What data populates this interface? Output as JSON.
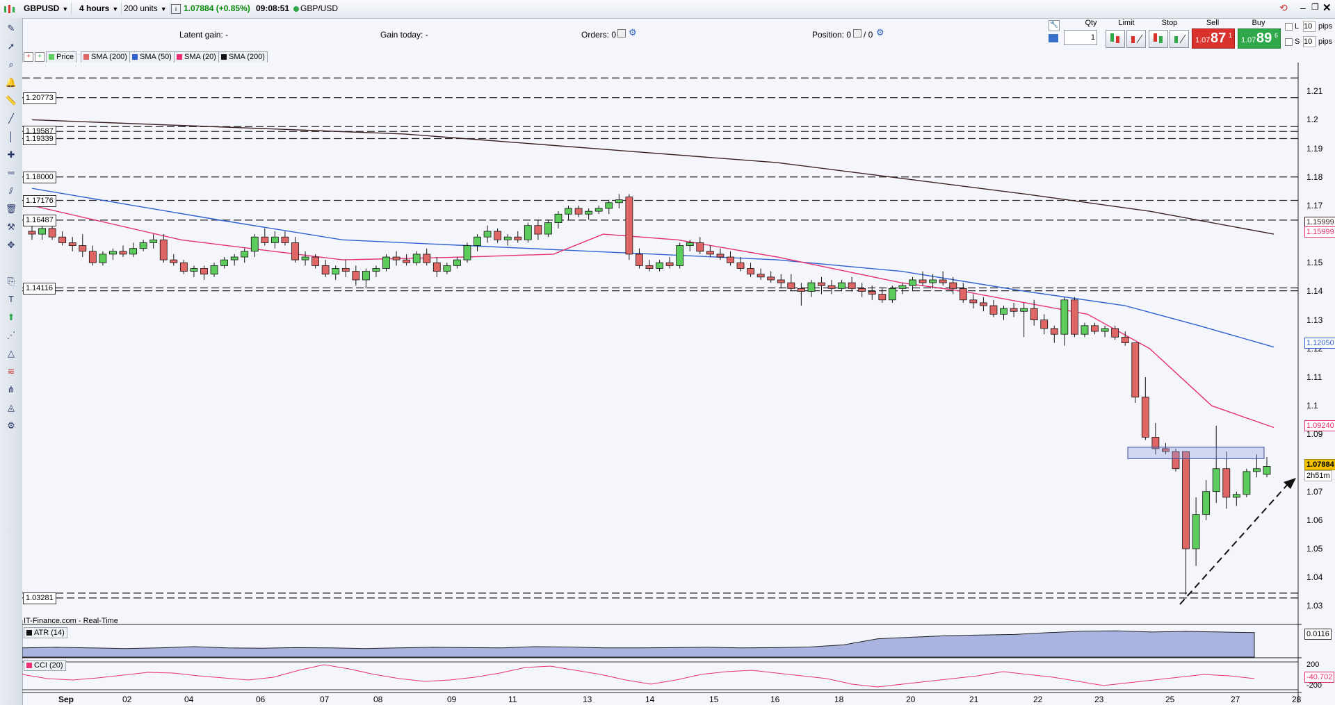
{
  "topbar": {
    "symbol": "GBPUSD",
    "timeframe": "4 hours",
    "units": "200 units",
    "price_change": "1.07884 (+0.85%)",
    "time": "09:08:51",
    "pair": "GBP/USD"
  },
  "infobar": {
    "latent_gain_label": "Latent gain:",
    "latent_gain_value": "-",
    "gain_today_label": "Gain today:",
    "gain_today_value": "-",
    "orders_label": "Orders:",
    "orders_value": "0",
    "position_label": "Position:",
    "position_value": "0",
    "position_sep": "/ 0"
  },
  "trade": {
    "qty_label": "Qty",
    "qty_value": "1",
    "limit_label": "Limit",
    "stop_label": "Stop",
    "sell_label": "Sell",
    "buy_label": "Buy",
    "sell_small": "1.07",
    "sell_big": "87",
    "sell_sup": "1",
    "buy_small": "1.07",
    "buy_big": "89",
    "buy_sup": "6",
    "l_label": "L",
    "s_label": "S",
    "l_pips": "10",
    "s_pips": "10",
    "pips_label": "pips"
  },
  "legend": {
    "price": "Price",
    "sma200a": "SMA (200)",
    "sma50": "SMA (50)",
    "sma20": "SMA (20)",
    "sma200b": "SMA (200)"
  },
  "colors": {
    "up": "#5ccc5c",
    "down": "#e06666",
    "sma200": "#3a2020",
    "sma50": "#3060d0",
    "sma20": "#e83070",
    "atr_fill": "#aab4e0",
    "zone": "#8f9de0"
  },
  "levels": [
    "1.20773",
    "1.19587",
    "1.19339",
    "1.18000",
    "1.17176",
    "1.16487",
    "1.14116",
    "1.03281"
  ],
  "right_badges": {
    "sma200": "1.15999",
    "sma20_top": "1.15999",
    "sma50": "1.12050",
    "sma20": "1.09240",
    "price": "1.07884",
    "countdown": "2h51m"
  },
  "source_label": "IT-Finance.com - Real-Time",
  "atr": {
    "label": "ATR (14)",
    "value": "0.0116"
  },
  "cci": {
    "label": "CCI (20)",
    "value": "-40.702",
    "upper": "200",
    "lower": "-200"
  },
  "chart_data": {
    "type": "candlestick",
    "ylim": [
      1.025,
      1.22
    ],
    "yticks": [
      "1.21",
      "1.2",
      "1.19",
      "1.18",
      "1.17",
      "1.16",
      "1.15",
      "1.14",
      "1.13",
      "1.12",
      "1.11",
      "1.1",
      "1.09",
      "1.08",
      "1.07",
      "1.06",
      "1.05",
      "1.04",
      "1.03"
    ],
    "xticks": [
      "Sep",
      "02",
      "04",
      "06",
      "07",
      "08",
      "09",
      "11",
      "13",
      "14",
      "15",
      "16",
      "18",
      "20",
      "21",
      "22",
      "23",
      "25",
      "27",
      "28"
    ],
    "dashed_levels": [
      1.2146,
      1.2077,
      1.1976,
      1.1959,
      1.1934,
      1.18,
      1.1718,
      1.1649,
      1.1412,
      1.1402,
      1.0345,
      1.0328
    ],
    "candles": [
      [
        1.161,
        1.164,
        1.158,
        1.16
      ],
      [
        1.16,
        1.163,
        1.158,
        1.162
      ],
      [
        1.162,
        1.164,
        1.158,
        1.159
      ],
      [
        1.159,
        1.161,
        1.156,
        1.157
      ],
      [
        1.157,
        1.159,
        1.154,
        1.156
      ],
      [
        1.156,
        1.16,
        1.152,
        1.154
      ],
      [
        1.154,
        1.156,
        1.149,
        1.15
      ],
      [
        1.15,
        1.154,
        1.149,
        1.153
      ],
      [
        1.153,
        1.155,
        1.151,
        1.154
      ],
      [
        1.154,
        1.156,
        1.152,
        1.153
      ],
      [
        1.153,
        1.157,
        1.152,
        1.155
      ],
      [
        1.155,
        1.158,
        1.154,
        1.157
      ],
      [
        1.157,
        1.16,
        1.155,
        1.158
      ],
      [
        1.158,
        1.16,
        1.15,
        1.151
      ],
      [
        1.151,
        1.153,
        1.149,
        1.15
      ],
      [
        1.15,
        1.151,
        1.146,
        1.147
      ],
      [
        1.147,
        1.149,
        1.145,
        1.148
      ],
      [
        1.148,
        1.149,
        1.144,
        1.146
      ],
      [
        1.146,
        1.15,
        1.145,
        1.149
      ],
      [
        1.149,
        1.152,
        1.148,
        1.151
      ],
      [
        1.151,
        1.153,
        1.149,
        1.152
      ],
      [
        1.152,
        1.155,
        1.15,
        1.154
      ],
      [
        1.154,
        1.16,
        1.152,
        1.159
      ],
      [
        1.159,
        1.162,
        1.156,
        1.157
      ],
      [
        1.157,
        1.161,
        1.155,
        1.159
      ],
      [
        1.159,
        1.161,
        1.156,
        1.157
      ],
      [
        1.157,
        1.159,
        1.15,
        1.151
      ],
      [
        1.151,
        1.154,
        1.149,
        1.152
      ],
      [
        1.152,
        1.153,
        1.148,
        1.149
      ],
      [
        1.149,
        1.151,
        1.145,
        1.146
      ],
      [
        1.146,
        1.149,
        1.144,
        1.148
      ],
      [
        1.148,
        1.151,
        1.145,
        1.147
      ],
      [
        1.147,
        1.149,
        1.142,
        1.144
      ],
      [
        1.144,
        1.148,
        1.141,
        1.147
      ],
      [
        1.147,
        1.149,
        1.145,
        1.148
      ],
      [
        1.148,
        1.153,
        1.147,
        1.152
      ],
      [
        1.152,
        1.154,
        1.149,
        1.151
      ],
      [
        1.151,
        1.153,
        1.149,
        1.15
      ],
      [
        1.15,
        1.154,
        1.149,
        1.153
      ],
      [
        1.153,
        1.155,
        1.149,
        1.15
      ],
      [
        1.15,
        1.152,
        1.145,
        1.147
      ],
      [
        1.147,
        1.15,
        1.146,
        1.149
      ],
      [
        1.149,
        1.152,
        1.148,
        1.151
      ],
      [
        1.151,
        1.157,
        1.15,
        1.156
      ],
      [
        1.156,
        1.16,
        1.154,
        1.159
      ],
      [
        1.159,
        1.163,
        1.157,
        1.161
      ],
      [
        1.161,
        1.162,
        1.157,
        1.158
      ],
      [
        1.158,
        1.16,
        1.156,
        1.159
      ],
      [
        1.159,
        1.161,
        1.157,
        1.158
      ],
      [
        1.158,
        1.164,
        1.157,
        1.163
      ],
      [
        1.163,
        1.165,
        1.158,
        1.16
      ],
      [
        1.16,
        1.165,
        1.159,
        1.164
      ],
      [
        1.164,
        1.168,
        1.162,
        1.167
      ],
      [
        1.167,
        1.17,
        1.165,
        1.169
      ],
      [
        1.169,
        1.17,
        1.166,
        1.167
      ],
      [
        1.167,
        1.169,
        1.165,
        1.168
      ],
      [
        1.168,
        1.17,
        1.167,
        1.169
      ],
      [
        1.169,
        1.172,
        1.167,
        1.171
      ],
      [
        1.171,
        1.174,
        1.169,
        1.172
      ],
      [
        1.173,
        1.174,
        1.151,
        1.153
      ],
      [
        1.153,
        1.155,
        1.148,
        1.149
      ],
      [
        1.149,
        1.151,
        1.147,
        1.148
      ],
      [
        1.148,
        1.151,
        1.147,
        1.15
      ],
      [
        1.15,
        1.152,
        1.148,
        1.149
      ],
      [
        1.149,
        1.157,
        1.148,
        1.156
      ],
      [
        1.156,
        1.158,
        1.154,
        1.157
      ],
      [
        1.157,
        1.159,
        1.153,
        1.154
      ],
      [
        1.154,
        1.156,
        1.152,
        1.153
      ],
      [
        1.153,
        1.155,
        1.151,
        1.152
      ],
      [
        1.152,
        1.154,
        1.149,
        1.15
      ],
      [
        1.15,
        1.152,
        1.147,
        1.148
      ],
      [
        1.148,
        1.15,
        1.145,
        1.146
      ],
      [
        1.146,
        1.148,
        1.144,
        1.145
      ],
      [
        1.145,
        1.147,
        1.143,
        1.144
      ],
      [
        1.144,
        1.146,
        1.141,
        1.143
      ],
      [
        1.143,
        1.146,
        1.14,
        1.141
      ],
      [
        1.141,
        1.143,
        1.135,
        1.14
      ],
      [
        1.14,
        1.144,
        1.138,
        1.143
      ],
      [
        1.143,
        1.145,
        1.139,
        1.142
      ],
      [
        1.142,
        1.144,
        1.139,
        1.141
      ],
      [
        1.141,
        1.144,
        1.14,
        1.143
      ],
      [
        1.143,
        1.145,
        1.14,
        1.141
      ],
      [
        1.141,
        1.143,
        1.138,
        1.14
      ],
      [
        1.14,
        1.142,
        1.137,
        1.139
      ],
      [
        1.139,
        1.141,
        1.136,
        1.137
      ],
      [
        1.137,
        1.142,
        1.136,
        1.141
      ],
      [
        1.141,
        1.143,
        1.139,
        1.142
      ],
      [
        1.142,
        1.145,
        1.14,
        1.144
      ],
      [
        1.144,
        1.147,
        1.142,
        1.143
      ],
      [
        1.143,
        1.146,
        1.141,
        1.144
      ],
      [
        1.144,
        1.147,
        1.142,
        1.143
      ],
      [
        1.143,
        1.145,
        1.139,
        1.141
      ],
      [
        1.141,
        1.143,
        1.136,
        1.137
      ],
      [
        1.137,
        1.139,
        1.134,
        1.136
      ],
      [
        1.136,
        1.138,
        1.133,
        1.135
      ],
      [
        1.135,
        1.137,
        1.131,
        1.132
      ],
      [
        1.132,
        1.135,
        1.13,
        1.134
      ],
      [
        1.134,
        1.136,
        1.131,
        1.133
      ],
      [
        1.133,
        1.136,
        1.124,
        1.134
      ],
      [
        1.134,
        1.137,
        1.128,
        1.13
      ],
      [
        1.13,
        1.132,
        1.125,
        1.127
      ],
      [
        1.127,
        1.128,
        1.122,
        1.125
      ],
      [
        1.125,
        1.138,
        1.121,
        1.137
      ],
      [
        1.137,
        1.138,
        1.124,
        1.125
      ],
      [
        1.125,
        1.129,
        1.124,
        1.128
      ],
      [
        1.128,
        1.129,
        1.125,
        1.126
      ],
      [
        1.126,
        1.128,
        1.124,
        1.127
      ],
      [
        1.127,
        1.128,
        1.123,
        1.124
      ],
      [
        1.124,
        1.126,
        1.121,
        1.122
      ],
      [
        1.122,
        1.122,
        1.101,
        1.103
      ],
      [
        1.103,
        1.11,
        1.088,
        1.089
      ],
      [
        1.089,
        1.094,
        1.083,
        1.085
      ],
      [
        1.085,
        1.087,
        1.083,
        1.084
      ],
      [
        1.084,
        1.085,
        1.077,
        1.078
      ],
      [
        1.084,
        1.084,
        1.034,
        1.05
      ],
      [
        1.05,
        1.068,
        1.044,
        1.062
      ],
      [
        1.062,
        1.074,
        1.06,
        1.07
      ],
      [
        1.07,
        1.093,
        1.066,
        1.078
      ],
      [
        1.078,
        1.084,
        1.064,
        1.068
      ],
      [
        1.068,
        1.07,
        1.065,
        1.069
      ],
      [
        1.069,
        1.078,
        1.068,
        1.077
      ],
      [
        1.077,
        1.083,
        1.075,
        1.078
      ],
      [
        1.076,
        1.082,
        1.075,
        1.0788
      ]
    ],
    "sma200": [
      [
        0,
        1.2
      ],
      [
        0.3,
        1.195
      ],
      [
        0.6,
        1.185
      ],
      [
        0.8,
        1.174
      ],
      [
        0.9,
        1.168
      ],
      [
        1.0,
        1.16
      ]
    ],
    "sma50": [
      [
        0,
        1.176
      ],
      [
        0.15,
        1.165
      ],
      [
        0.25,
        1.158
      ],
      [
        0.45,
        1.154
      ],
      [
        0.6,
        1.151
      ],
      [
        0.7,
        1.147
      ],
      [
        0.8,
        1.14
      ],
      [
        0.88,
        1.135
      ],
      [
        0.94,
        1.128
      ],
      [
        1.0,
        1.1205
      ]
    ],
    "sma20": [
      [
        0,
        1.17
      ],
      [
        0.12,
        1.158
      ],
      [
        0.25,
        1.151
      ],
      [
        0.35,
        1.152
      ],
      [
        0.42,
        1.153
      ],
      [
        0.46,
        1.16
      ],
      [
        0.52,
        1.158
      ],
      [
        0.6,
        1.152
      ],
      [
        0.7,
        1.143
      ],
      [
        0.75,
        1.14
      ],
      [
        0.8,
        1.136
      ],
      [
        0.85,
        1.132
      ],
      [
        0.9,
        1.12
      ],
      [
        0.95,
        1.1
      ],
      [
        1.0,
        1.0924
      ]
    ],
    "resistance_zone": [
      1.0815,
      1.0855
    ],
    "atr_series": [
      0.3,
      0.32,
      0.3,
      0.28,
      0.3,
      0.34,
      0.3,
      0.29,
      0.31,
      0.3,
      0.28,
      0.3,
      0.32,
      0.31,
      0.3,
      0.34,
      0.33,
      0.3,
      0.3,
      0.31,
      0.32,
      0.3,
      0.31,
      0.33,
      0.4,
      0.6,
      0.65,
      0.7,
      0.72,
      0.74,
      0.8,
      0.85,
      0.86,
      0.82,
      0.84,
      0.82,
      0.8
    ],
    "cci_series": [
      20,
      -40,
      -60,
      -30,
      10,
      50,
      40,
      0,
      -30,
      -60,
      -20,
      80,
      160,
      100,
      20,
      -40,
      -80,
      -60,
      -20,
      40,
      120,
      140,
      80,
      20,
      -60,
      -120,
      -60,
      20,
      60,
      80,
      40,
      0,
      -40,
      -120,
      -160,
      -120,
      -80,
      -40,
      0,
      60,
      20,
      -20,
      -80,
      -140,
      -100,
      -60,
      -20,
      20,
      0,
      -40
    ]
  }
}
